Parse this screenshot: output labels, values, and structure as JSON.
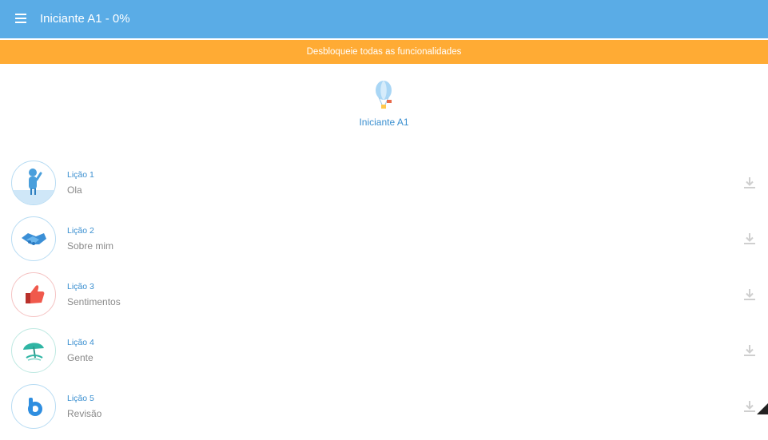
{
  "app_bar": {
    "title": "Iniciante A1 - 0%",
    "menu_icon": "menu-icon"
  },
  "banner": {
    "text": "Desbloqueie todas as funcionalidades"
  },
  "hero": {
    "label": "Iniciante A1",
    "icon": "balloon-icon"
  },
  "lessons": [
    {
      "number": "Lição 1",
      "name": "Ola",
      "icon": "person-waving-icon"
    },
    {
      "number": "Lição 2",
      "name": "Sobre mim",
      "icon": "handshake-icon"
    },
    {
      "number": "Lição 3",
      "name": "Sentimentos",
      "icon": "thumbs-up-icon"
    },
    {
      "number": "Lição 4",
      "name": "Gente",
      "icon": "beach-umbrella-icon"
    },
    {
      "number": "Lição 5",
      "name": "Revisão",
      "icon": "letter-b-icon"
    }
  ],
  "colors": {
    "app_bar": "#5aace6",
    "banner": "#ffab34",
    "accent_text": "#3a8fd0",
    "lesson_name": "#8a8a8a"
  }
}
